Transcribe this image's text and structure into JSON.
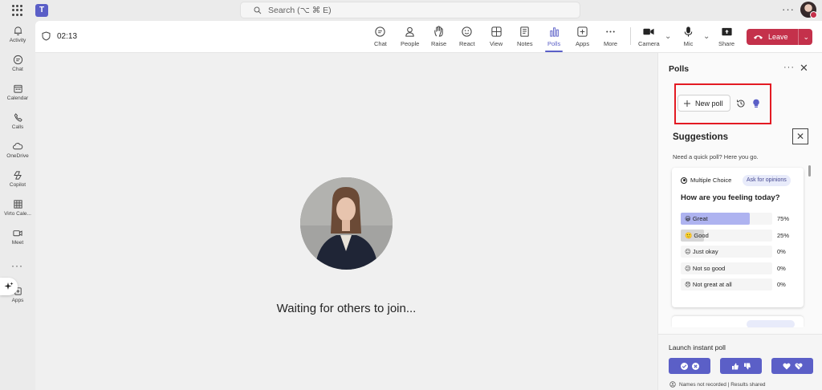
{
  "search": {
    "placeholder": "Search (⌥ ⌘ E)"
  },
  "meeting": {
    "timer": "02:13",
    "waiting_text": "Waiting for others to join..."
  },
  "rail": {
    "items": [
      {
        "label": "Activity",
        "icon": "bell-icon"
      },
      {
        "label": "Chat",
        "icon": "chat-icon"
      },
      {
        "label": "Calendar",
        "icon": "calendar-icon"
      },
      {
        "label": "Calls",
        "icon": "phone-icon"
      },
      {
        "label": "OneDrive",
        "icon": "cloud-icon"
      },
      {
        "label": "Copilot",
        "icon": "copilot-icon"
      },
      {
        "label": "Virto Cale...",
        "icon": "grid-calendar-icon"
      },
      {
        "label": "Meet",
        "icon": "video-icon"
      },
      {
        "label": "Apps",
        "icon": "apps-icon"
      }
    ]
  },
  "toolbar": {
    "chat": "Chat",
    "people": "People",
    "raise": "Raise",
    "react": "React",
    "view": "View",
    "notes": "Notes",
    "polls": "Polls",
    "apps": "Apps",
    "more": "More",
    "camera": "Camera",
    "mic": "Mic",
    "share": "Share",
    "leave": "Leave"
  },
  "polls_panel": {
    "title": "Polls",
    "new_poll": "New poll",
    "suggestions_title": "Suggestions",
    "suggestions_sub": "Need a quick poll? Here you go.",
    "card": {
      "type": "Multiple Choice",
      "tag": "Ask for opinions",
      "question": "How are you feeling today?",
      "options": [
        {
          "label": "😀 Great",
          "percent": 75,
          "pct_text": "75%"
        },
        {
          "label": "🙂 Good",
          "percent": 25,
          "pct_text": "25%"
        },
        {
          "label": "😐 Just okay",
          "percent": 0,
          "pct_text": "0%"
        },
        {
          "label": "😕 Not so good",
          "percent": 0,
          "pct_text": "0%"
        },
        {
          "label": "😞 Not great at all",
          "percent": 0,
          "pct_text": "0%"
        }
      ]
    },
    "launch_title": "Launch instant poll",
    "footer": "Names not recorded | Results shared"
  },
  "colors": {
    "accent": "#5b5fc7",
    "leave": "#c4314b",
    "highlight": "#e31a23",
    "bar_primary": "#aeb3f0",
    "bar_secondary": "#d6d6d6"
  }
}
